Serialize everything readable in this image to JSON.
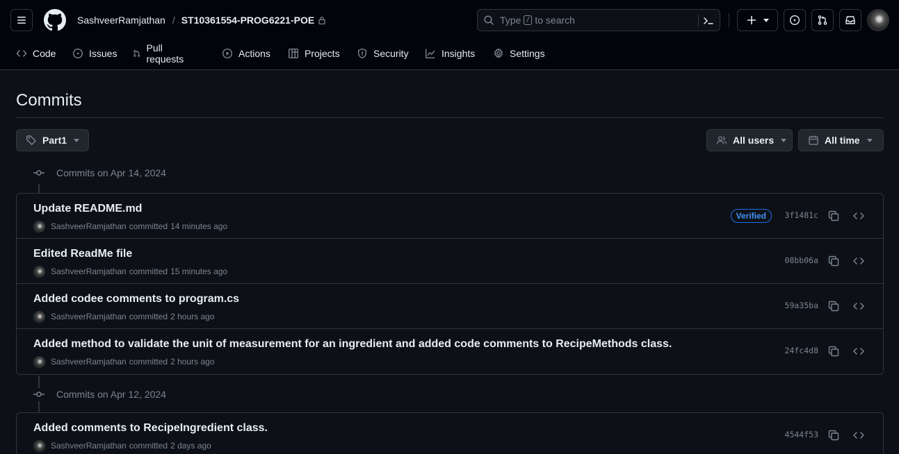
{
  "header": {
    "owner": "SashveerRamjathan",
    "separator": "/",
    "repo": "ST10361554-PROG6221-POE",
    "search": {
      "prefix": "Type",
      "key": "/",
      "suffix": "to search"
    }
  },
  "nav": {
    "tabs": [
      {
        "label": "Code",
        "icon": "code-icon"
      },
      {
        "label": "Issues",
        "icon": "issue-icon"
      },
      {
        "label": "Pull requests",
        "icon": "pull-request-icon"
      },
      {
        "label": "Actions",
        "icon": "play-icon"
      },
      {
        "label": "Projects",
        "icon": "table-icon"
      },
      {
        "label": "Security",
        "icon": "shield-icon"
      },
      {
        "label": "Insights",
        "icon": "graph-icon"
      },
      {
        "label": "Settings",
        "icon": "gear-icon"
      }
    ]
  },
  "page": {
    "title": "Commits",
    "branch_button": "Part1",
    "users_button": "All users",
    "time_button": "All time"
  },
  "groups": [
    {
      "heading": "Commits on Apr 14, 2024",
      "commits": [
        {
          "title": "Update README.md",
          "author": "SashveerRamjathan",
          "verb": "committed",
          "when": "14 minutes ago",
          "sha": "3f1481c",
          "verified": "Verified"
        },
        {
          "title": "Edited ReadMe file",
          "author": "SashveerRamjathan",
          "verb": "committed",
          "when": "15 minutes ago",
          "sha": "08bb06a"
        },
        {
          "title": "Added codee comments to program.cs",
          "author": "SashveerRamjathan",
          "verb": "committed",
          "when": "2 hours ago",
          "sha": "59a35ba"
        },
        {
          "title": "Added method to validate the unit of measurement for an ingredient and added code comments to RecipeMethods class.",
          "author": "SashveerRamjathan",
          "verb": "committed",
          "when": "2 hours ago",
          "sha": "24fc4d8"
        }
      ]
    },
    {
      "heading": "Commits on Apr 12, 2024",
      "commits": [
        {
          "title": "Added comments to RecipeIngredient class.",
          "author": "SashveerRamjathan",
          "verb": "committed",
          "when": "2 days ago",
          "sha": "4544f53"
        }
      ]
    }
  ],
  "colors": {
    "background": "#0d1117",
    "header_background": "#010409",
    "border": "#30363d",
    "muted_text": "#7d8590",
    "verified_blue": "#4493f8"
  }
}
